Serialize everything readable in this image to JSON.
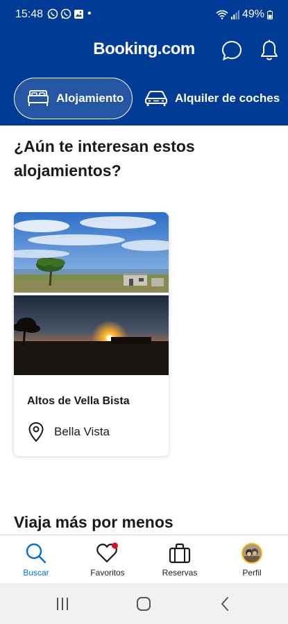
{
  "status_bar": {
    "time": "15:48",
    "dot": "•",
    "battery": "49%",
    "icons": [
      "whatsapp-icon",
      "whatsapp-icon",
      "gallery-icon",
      "wifi-icon",
      "signal-icon",
      "battery-icon"
    ]
  },
  "header": {
    "logo": "Booking.com",
    "icons": [
      "chat-icon",
      "bell-icon"
    ],
    "tabs": [
      {
        "label": "Alojamiento",
        "icon": "bed-icon",
        "selected": true
      },
      {
        "label": "Alquiler de coches",
        "icon": "car-icon",
        "selected": false
      }
    ]
  },
  "main": {
    "recent_title": "¿Aún te interesan estos alojamientos?",
    "card": {
      "name": "Altos de Vella Bista",
      "location": "Bella Vista",
      "location_icon": "map-pin-icon"
    },
    "section2_title": "Viaja más por menos"
  },
  "bottom_nav": {
    "items": [
      {
        "label": "Buscar",
        "icon": "search-icon",
        "active": true
      },
      {
        "label": "Favoritos",
        "icon": "heart-icon",
        "active": false
      },
      {
        "label": "Reservas",
        "icon": "suitcase-icon",
        "active": false
      },
      {
        "label": "Perfil",
        "icon": "avatar-icon",
        "active": false
      }
    ]
  },
  "colors": {
    "brand": "#003b95",
    "accent_blue": "#006ce4",
    "notification_red": "#d4111e",
    "avatar_ring": "#febb02"
  }
}
